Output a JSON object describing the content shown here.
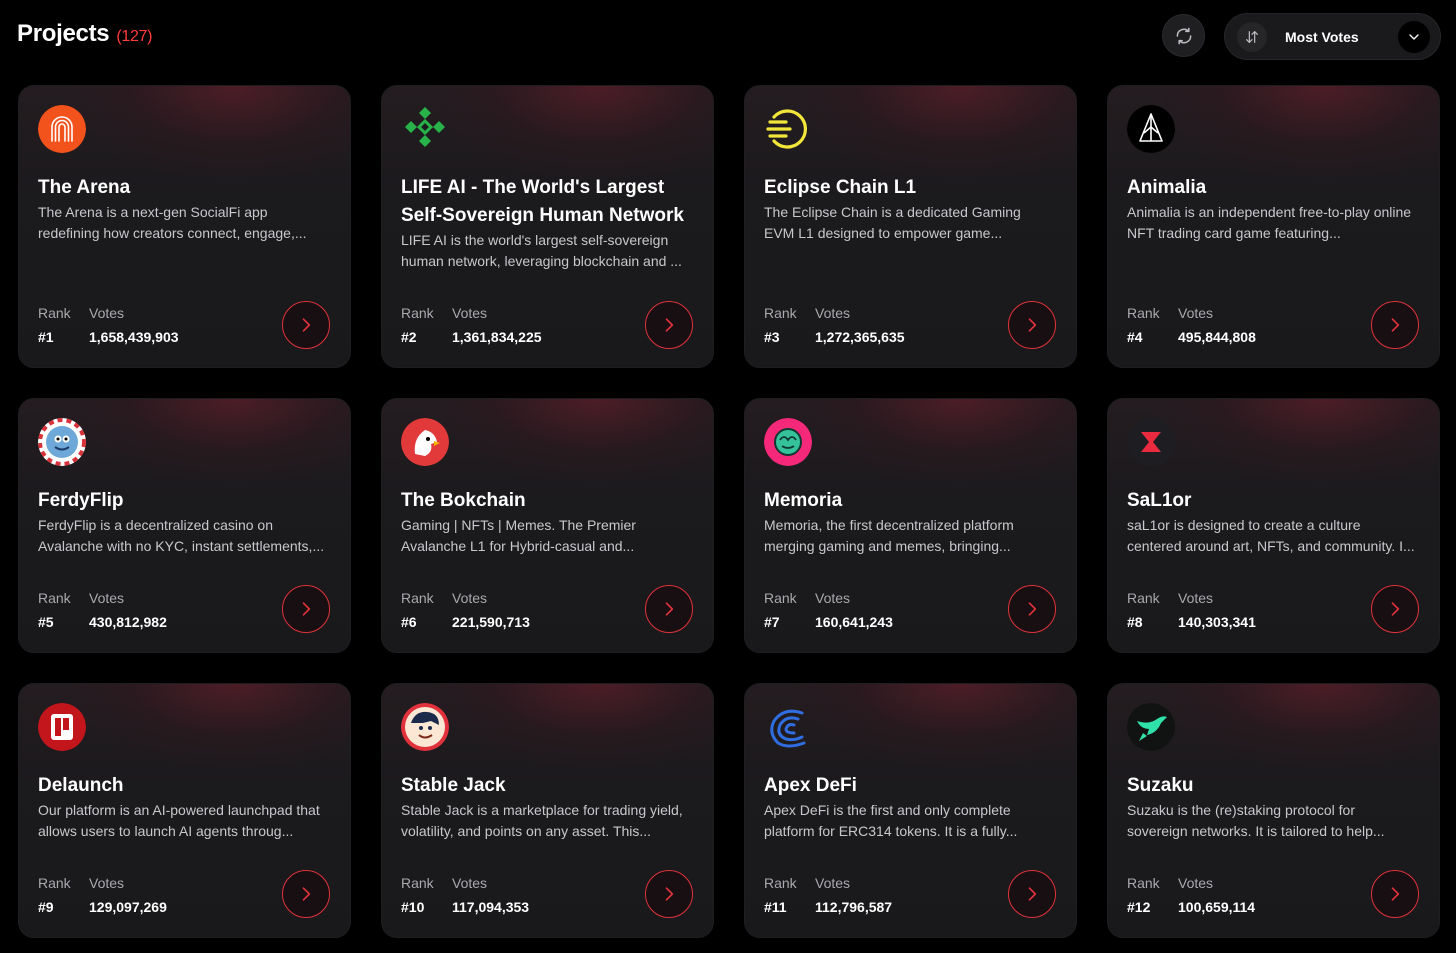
{
  "header": {
    "title": "Projects",
    "count": "(127)",
    "refresh_icon": "refresh-icon",
    "sort_label": "Most Votes",
    "sort_icon": "sort-arrows-icon",
    "dropdown_icon": "chevron-down-icon"
  },
  "labels": {
    "rank": "Rank",
    "votes": "Votes"
  },
  "colors": {
    "accent": "#e0323c",
    "background": "#000000",
    "card": "#1b1a1d"
  },
  "projects": [
    {
      "name": "The Arena",
      "description": "The Arena is a next-gen SocialFi app redefining how creators connect, engage,...",
      "rank": "#1",
      "votes": "1,658,439,903",
      "logo": "arena-logo"
    },
    {
      "name": "LIFE AI - The World's Largest Self-Sovereign Human Network",
      "description": "LIFE AI is the world's largest self-sovereign human network, leveraging blockchain and ...",
      "rank": "#2",
      "votes": "1,361,834,225",
      "logo": "life-ai-logo"
    },
    {
      "name": "Eclipse Chain L1",
      "description": "The Eclipse Chain is a dedicated Gaming EVM L1 designed to empower game...",
      "rank": "#3",
      "votes": "1,272,365,635",
      "logo": "eclipse-logo"
    },
    {
      "name": "Animalia",
      "description": "Animalia is an independent free-to-play online NFT trading card game featuring...",
      "rank": "#4",
      "votes": "495,844,808",
      "logo": "animalia-logo"
    },
    {
      "name": "FerdyFlip",
      "description": "FerdyFlip is a decentralized casino on Avalanche with no KYC, instant settlements,...",
      "rank": "#5",
      "votes": "430,812,982",
      "logo": "ferdyflip-logo"
    },
    {
      "name": "The Bokchain",
      "description": "Gaming | NFTs | Memes. The Premier Avalanche L1 for Hybrid-casual and...",
      "rank": "#6",
      "votes": "221,590,713",
      "logo": "bokchain-logo"
    },
    {
      "name": "Memoria",
      "description": "Memoria, the first decentralized platform merging gaming and memes, bringing...",
      "rank": "#7",
      "votes": "160,641,243",
      "logo": "memoria-logo"
    },
    {
      "name": "SaL1or",
      "description": "saL1or is designed to create a culture centered around art, NFTs, and community. I...",
      "rank": "#8",
      "votes": "140,303,341",
      "logo": "sal1or-logo"
    },
    {
      "name": "Delaunch",
      "description": "Our platform is an AI-powered launchpad that allows users to launch AI agents throug...",
      "rank": "#9",
      "votes": "129,097,269",
      "logo": "delaunch-logo"
    },
    {
      "name": "Stable Jack",
      "description": "Stable Jack is a marketplace for trading yield, volatility, and points on any asset. This...",
      "rank": "#10",
      "votes": "117,094,353",
      "logo": "stable-jack-logo"
    },
    {
      "name": "Apex DeFi",
      "description": "Apex DeFi is the first and only complete platform for ERC314 tokens. It is a fully...",
      "rank": "#11",
      "votes": "112,796,587",
      "logo": "apex-defi-logo"
    },
    {
      "name": "Suzaku",
      "description": "Suzaku is the (re)staking protocol for sovereign networks. It is tailored to help...",
      "rank": "#12",
      "votes": "100,659,114",
      "logo": "suzaku-logo"
    }
  ]
}
